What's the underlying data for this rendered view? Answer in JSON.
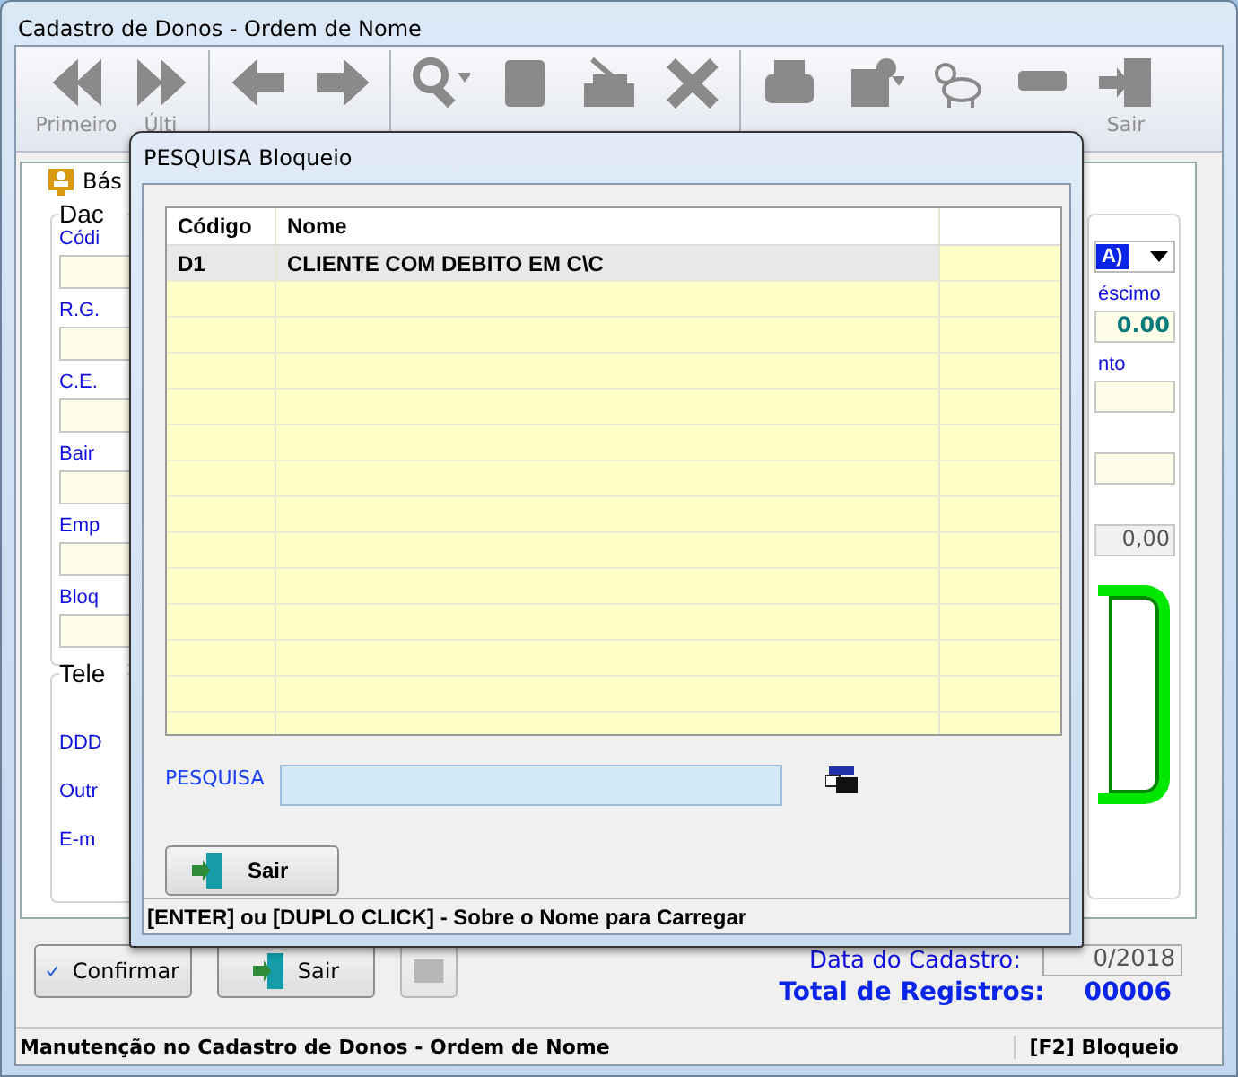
{
  "window": {
    "title": "Cadastro de Donos - Ordem de Nome"
  },
  "toolbar": [
    {
      "label": "Primeiro",
      "disabled": true
    },
    {
      "label": "Últi",
      "disabled": true
    },
    {
      "disabled": true
    },
    {
      "disabled": true
    },
    {
      "disabled": true
    },
    {
      "disabled": true
    },
    {
      "disabled": true
    },
    {
      "disabled": true
    },
    {
      "disabled": true
    },
    {
      "disabled": true
    },
    {
      "disabled": true
    },
    {
      "disabled": true
    },
    {
      "label": "Sair",
      "disabled": true
    }
  ],
  "tab": {
    "label": "Bás"
  },
  "group_1": {
    "title": "Dac",
    "fields": [
      "Códi",
      "R.G.",
      "C.E.",
      "Bair",
      "Emp",
      "Bloq"
    ]
  },
  "group_2": {
    "title": "Tele",
    "labels": [
      "DDD",
      "Outr",
      "E-m"
    ]
  },
  "right_panel": {
    "dropdown_value": "A)",
    "label_1": "éscimo",
    "value_1": "0.00",
    "label_2": "nto",
    "value_3": "0,00"
  },
  "buttons": [
    {
      "label": "Confirmar",
      "disabled": false
    },
    {
      "label": "Sair",
      "disabled": false
    },
    {
      "disabled": true
    }
  ],
  "registration": {
    "date_label": "Data do Cadastro:",
    "date_value": "0/2018",
    "total_label": "Total de Registros:",
    "total_value": "00006"
  },
  "status_bar": [
    "Manutenção no Cadastro de Donos - Ordem de Nome",
    "[F2] Bloqueio"
  ],
  "dialog": {
    "title": "PESQUISA Bloqueio",
    "table": {
      "columns": [
        "Código",
        "Nome"
      ],
      "rows": [
        {
          "cells": [
            "D1",
            "CLIENTE COM DEBITO EM C\\C"
          ],
          "selected": true
        }
      ]
    },
    "search": {
      "label": "PESQUISA"
    },
    "exit_button": "Sair",
    "hint": "[ENTER] ou [DUPLO CLICK] - Sobre o Nome para Carregar"
  }
}
